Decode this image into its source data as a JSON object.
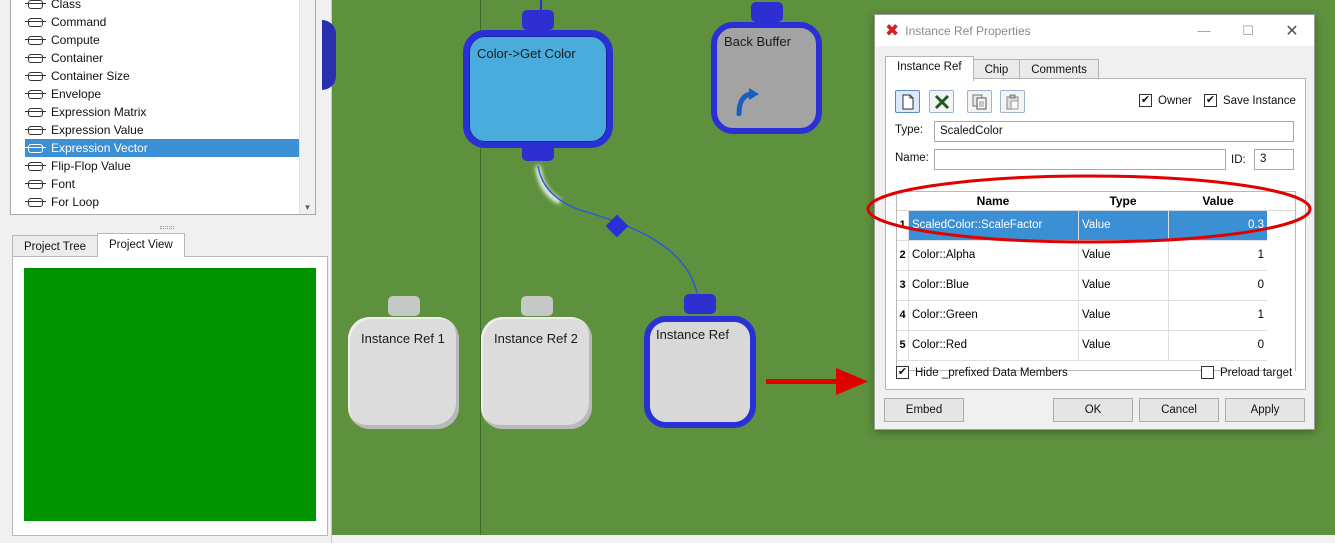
{
  "chip_list": {
    "items": [
      {
        "label": "Class",
        "selected": false
      },
      {
        "label": "Command",
        "selected": false
      },
      {
        "label": "Compute",
        "selected": false
      },
      {
        "label": "Container",
        "selected": false
      },
      {
        "label": "Container Size",
        "selected": false
      },
      {
        "label": "Envelope",
        "selected": false
      },
      {
        "label": "Expression Matrix",
        "selected": false
      },
      {
        "label": "Expression Value",
        "selected": false
      },
      {
        "label": "Expression Vector",
        "selected": true
      },
      {
        "label": "Flip-Flop Value",
        "selected": false
      },
      {
        "label": "Font",
        "selected": false
      },
      {
        "label": "For Loop",
        "selected": false
      }
    ]
  },
  "left_tabs": [
    {
      "label": "Project Tree",
      "active": false
    },
    {
      "label": "Project View",
      "active": true
    }
  ],
  "colors": {
    "canvas": "#5d913d",
    "preview": "#009300",
    "selection": "#3b8fd4",
    "node_border": "#2a30d6",
    "annotation_red": "#e00000"
  },
  "nodes": {
    "get_color": "Color->Get Color",
    "back_buffer": "Back Buffer",
    "instance_ref_1": "Instance Ref 1",
    "instance_ref_2": "Instance Ref 2",
    "instance_ref": "Instance Ref"
  },
  "dialog": {
    "title": "Instance Ref Properties",
    "app_icon": "x-logo-icon",
    "tabs": [
      {
        "label": "Instance Ref",
        "active": true
      },
      {
        "label": "Chip",
        "active": false
      },
      {
        "label": "Comments",
        "active": false
      }
    ],
    "toolbar_icons": [
      "new-document-icon",
      "delete-x-icon",
      "copy-icon",
      "paste-icon"
    ],
    "owner_label": "Owner",
    "owner_checked": true,
    "save_instance_label": "Save Instance",
    "save_instance_checked": true,
    "type_label": "Type:",
    "type_value": "ScaledColor",
    "name_label": "Name:",
    "name_value": "",
    "id_label": "ID:",
    "id_value": "3",
    "grid": {
      "headers": [
        "Name",
        "Type",
        "Value"
      ],
      "rows": [
        {
          "num": "1",
          "name": "ScaledColor::ScaleFactor",
          "type": "Value",
          "value": "0.3",
          "selected": true
        },
        {
          "num": "2",
          "name": "Color::Alpha",
          "type": "Value",
          "value": "1",
          "selected": false
        },
        {
          "num": "3",
          "name": "Color::Blue",
          "type": "Value",
          "value": "0",
          "selected": false
        },
        {
          "num": "4",
          "name": "Color::Green",
          "type": "Value",
          "value": "1",
          "selected": false
        },
        {
          "num": "5",
          "name": "Color::Red",
          "type": "Value",
          "value": "0",
          "selected": false
        }
      ]
    },
    "hide_prefixed_label": "Hide _prefixed Data Members",
    "hide_prefixed_checked": true,
    "preload_target_label": "Preload target",
    "preload_target_checked": false,
    "buttons": {
      "embed": "Embed",
      "ok": "OK",
      "cancel": "Cancel",
      "apply": "Apply"
    }
  }
}
